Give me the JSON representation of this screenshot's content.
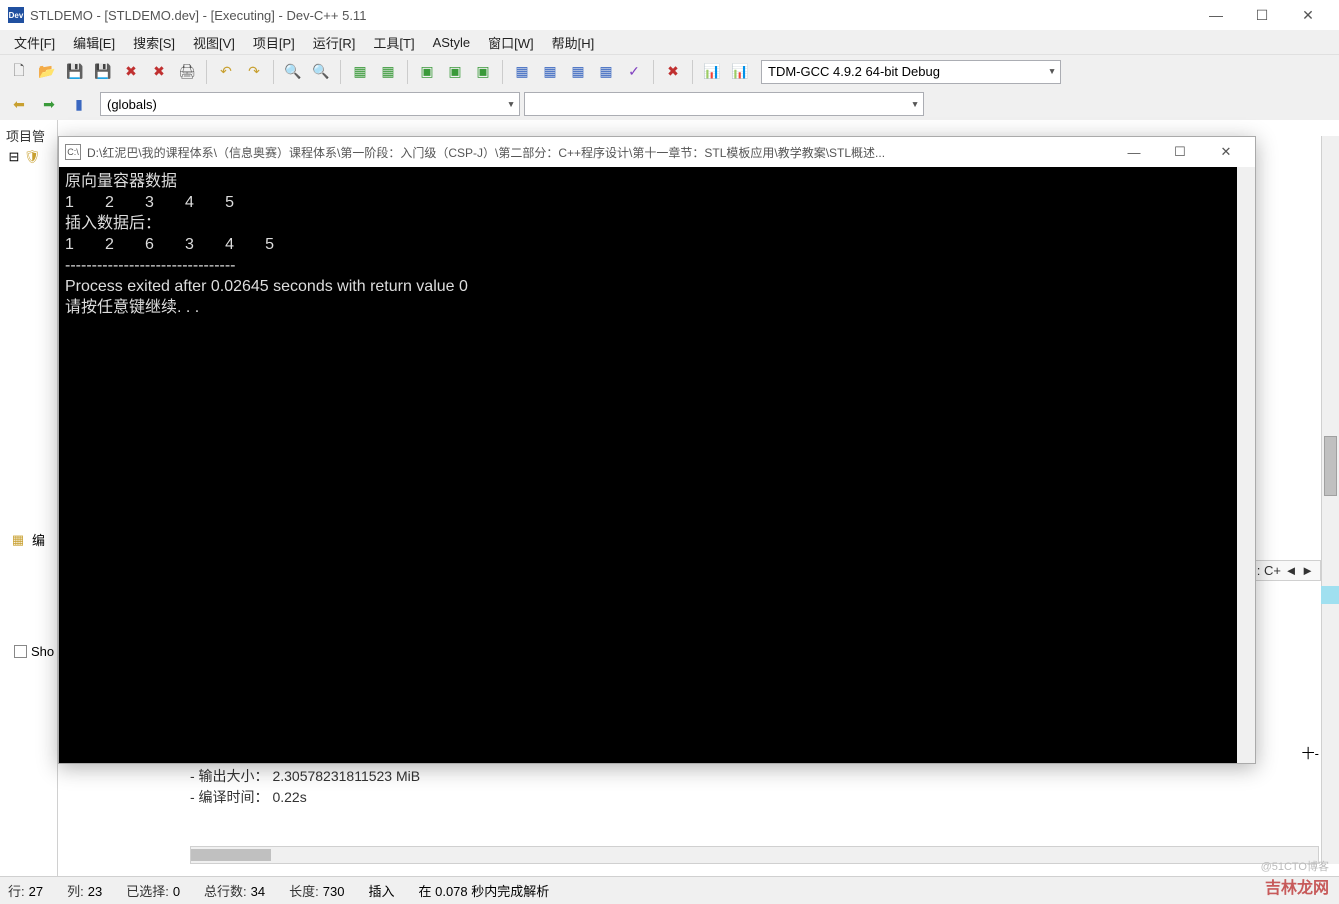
{
  "main": {
    "title": "STLDEMO - [STLDEMO.dev] - [Executing] - Dev-C++ 5.11",
    "menu": [
      "文件[F]",
      "编辑[E]",
      "搜索[S]",
      "视图[V]",
      "项目[P]",
      "运行[R]",
      "工具[T]",
      "AStyle",
      "窗口[W]",
      "帮助[H]"
    ],
    "compiler_selected": "TDM-GCC 4.9.2 64-bit Debug",
    "globals": "(globals)",
    "sidebar_title": "项目管",
    "bottom_tab": "编",
    "shorten": "Sho",
    "right_tab": ":   C+",
    "bottom_right": "十-",
    "log": [
      "- 输出大小： 2.30578231811523 MiB",
      "- 编译时间： 0.22s"
    ],
    "status": {
      "line_lbl": "行:",
      "line": "27",
      "col_lbl": "列:",
      "col": "23",
      "sel_lbl": "已选择:",
      "sel": "0",
      "total_lbl": "总行数:",
      "total": "34",
      "len_lbl": "长度:",
      "len": "730",
      "mode": "插入",
      "parse": "在 0.078 秒内完成解析"
    }
  },
  "console": {
    "title": "D:\\红泥巴\\我的课程体系\\（信息奥赛）课程体系\\第一阶段：入门级（CSP-J）\\第二部分：C++程序设计\\第十一章节：STL模板应用\\教学教案\\STL概述...",
    "lines": [
      "原向量容器数据",
      "1       2       3       4       5",
      "插入数据后：",
      "1       2       6       3       4       5",
      "--------------------------------",
      "Process exited after 0.02645 seconds with return value 0",
      "请按任意键继续. . ."
    ]
  },
  "watermark": "吉林龙网",
  "watermark2": "@51CTO博客"
}
